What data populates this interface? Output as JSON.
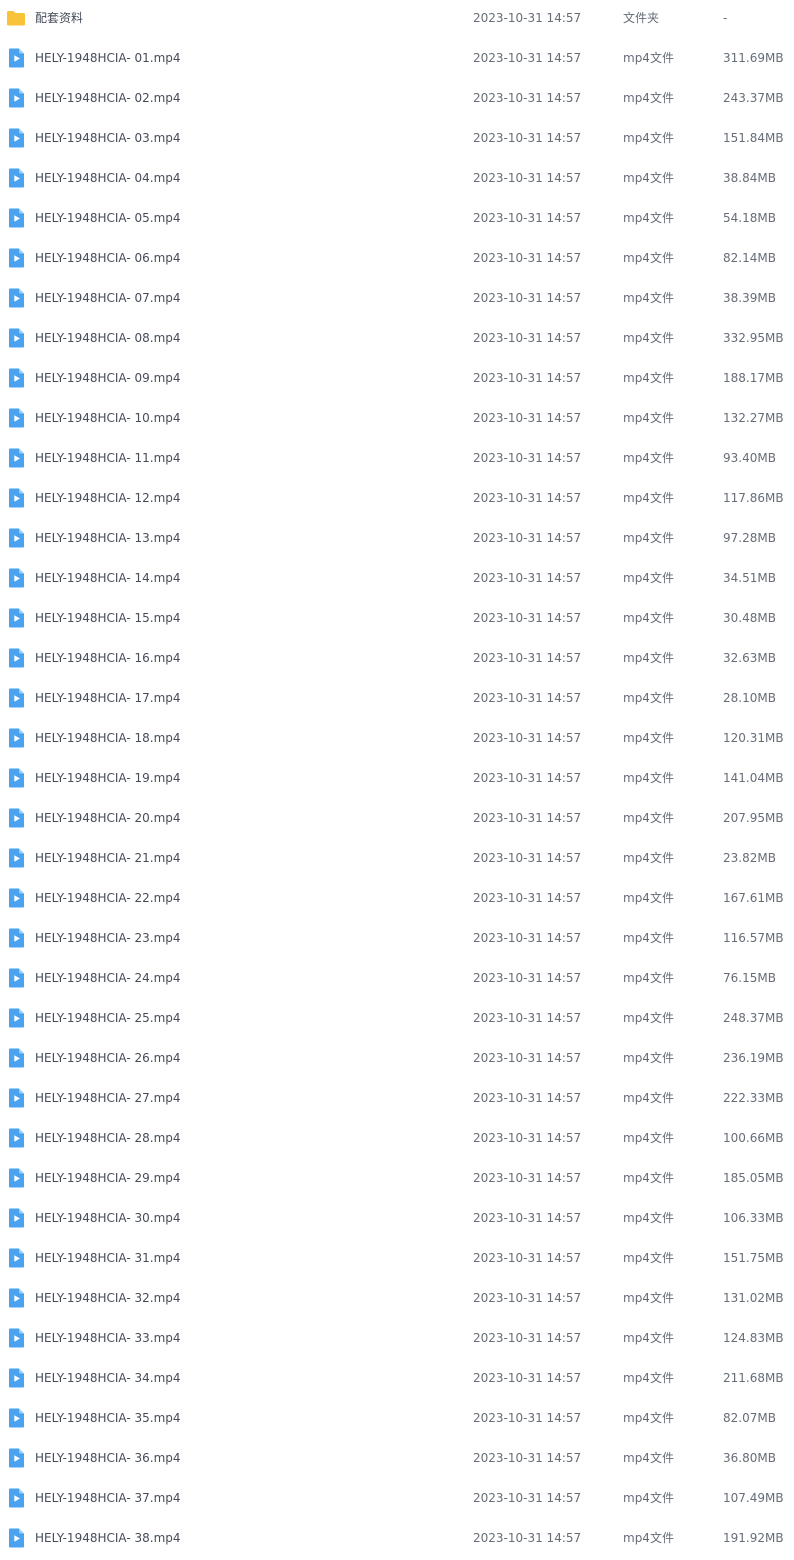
{
  "icons": {
    "folder": "folder-icon",
    "video": "video-file-icon"
  },
  "colors": {
    "folder": "#f8c33a",
    "video": "#4aa3f0"
  },
  "files": [
    {
      "icon": "folder",
      "name": "配套资料",
      "modified": "2023-10-31 14:57",
      "type": "文件夹",
      "size": "-"
    },
    {
      "icon": "video",
      "name": "HELY-1948HCIA- 01.mp4",
      "modified": "2023-10-31 14:57",
      "type": "mp4文件",
      "size": "311.69MB"
    },
    {
      "icon": "video",
      "name": "HELY-1948HCIA- 02.mp4",
      "modified": "2023-10-31 14:57",
      "type": "mp4文件",
      "size": "243.37MB"
    },
    {
      "icon": "video",
      "name": "HELY-1948HCIA- 03.mp4",
      "modified": "2023-10-31 14:57",
      "type": "mp4文件",
      "size": "151.84MB"
    },
    {
      "icon": "video",
      "name": "HELY-1948HCIA- 04.mp4",
      "modified": "2023-10-31 14:57",
      "type": "mp4文件",
      "size": "38.84MB"
    },
    {
      "icon": "video",
      "name": "HELY-1948HCIA- 05.mp4",
      "modified": "2023-10-31 14:57",
      "type": "mp4文件",
      "size": "54.18MB"
    },
    {
      "icon": "video",
      "name": "HELY-1948HCIA- 06.mp4",
      "modified": "2023-10-31 14:57",
      "type": "mp4文件",
      "size": "82.14MB"
    },
    {
      "icon": "video",
      "name": "HELY-1948HCIA- 07.mp4",
      "modified": "2023-10-31 14:57",
      "type": "mp4文件",
      "size": "38.39MB"
    },
    {
      "icon": "video",
      "name": "HELY-1948HCIA- 08.mp4",
      "modified": "2023-10-31 14:57",
      "type": "mp4文件",
      "size": "332.95MB"
    },
    {
      "icon": "video",
      "name": "HELY-1948HCIA- 09.mp4",
      "modified": "2023-10-31 14:57",
      "type": "mp4文件",
      "size": "188.17MB"
    },
    {
      "icon": "video",
      "name": "HELY-1948HCIA- 10.mp4",
      "modified": "2023-10-31 14:57",
      "type": "mp4文件",
      "size": "132.27MB"
    },
    {
      "icon": "video",
      "name": "HELY-1948HCIA- 11.mp4",
      "modified": "2023-10-31 14:57",
      "type": "mp4文件",
      "size": "93.40MB"
    },
    {
      "icon": "video",
      "name": "HELY-1948HCIA- 12.mp4",
      "modified": "2023-10-31 14:57",
      "type": "mp4文件",
      "size": "117.86MB"
    },
    {
      "icon": "video",
      "name": "HELY-1948HCIA- 13.mp4",
      "modified": "2023-10-31 14:57",
      "type": "mp4文件",
      "size": "97.28MB"
    },
    {
      "icon": "video",
      "name": "HELY-1948HCIA- 14.mp4",
      "modified": "2023-10-31 14:57",
      "type": "mp4文件",
      "size": "34.51MB"
    },
    {
      "icon": "video",
      "name": "HELY-1948HCIA- 15.mp4",
      "modified": "2023-10-31 14:57",
      "type": "mp4文件",
      "size": "30.48MB"
    },
    {
      "icon": "video",
      "name": "HELY-1948HCIA- 16.mp4",
      "modified": "2023-10-31 14:57",
      "type": "mp4文件",
      "size": "32.63MB"
    },
    {
      "icon": "video",
      "name": "HELY-1948HCIA- 17.mp4",
      "modified": "2023-10-31 14:57",
      "type": "mp4文件",
      "size": "28.10MB"
    },
    {
      "icon": "video",
      "name": "HELY-1948HCIA- 18.mp4",
      "modified": "2023-10-31 14:57",
      "type": "mp4文件",
      "size": "120.31MB"
    },
    {
      "icon": "video",
      "name": "HELY-1948HCIA- 19.mp4",
      "modified": "2023-10-31 14:57",
      "type": "mp4文件",
      "size": "141.04MB"
    },
    {
      "icon": "video",
      "name": "HELY-1948HCIA- 20.mp4",
      "modified": "2023-10-31 14:57",
      "type": "mp4文件",
      "size": "207.95MB"
    },
    {
      "icon": "video",
      "name": "HELY-1948HCIA- 21.mp4",
      "modified": "2023-10-31 14:57",
      "type": "mp4文件",
      "size": "23.82MB"
    },
    {
      "icon": "video",
      "name": "HELY-1948HCIA- 22.mp4",
      "modified": "2023-10-31 14:57",
      "type": "mp4文件",
      "size": "167.61MB"
    },
    {
      "icon": "video",
      "name": "HELY-1948HCIA- 23.mp4",
      "modified": "2023-10-31 14:57",
      "type": "mp4文件",
      "size": "116.57MB"
    },
    {
      "icon": "video",
      "name": "HELY-1948HCIA- 24.mp4",
      "modified": "2023-10-31 14:57",
      "type": "mp4文件",
      "size": "76.15MB"
    },
    {
      "icon": "video",
      "name": "HELY-1948HCIA- 25.mp4",
      "modified": "2023-10-31 14:57",
      "type": "mp4文件",
      "size": "248.37MB"
    },
    {
      "icon": "video",
      "name": "HELY-1948HCIA- 26.mp4",
      "modified": "2023-10-31 14:57",
      "type": "mp4文件",
      "size": "236.19MB"
    },
    {
      "icon": "video",
      "name": "HELY-1948HCIA- 27.mp4",
      "modified": "2023-10-31 14:57",
      "type": "mp4文件",
      "size": "222.33MB"
    },
    {
      "icon": "video",
      "name": "HELY-1948HCIA- 28.mp4",
      "modified": "2023-10-31 14:57",
      "type": "mp4文件",
      "size": "100.66MB"
    },
    {
      "icon": "video",
      "name": "HELY-1948HCIA- 29.mp4",
      "modified": "2023-10-31 14:57",
      "type": "mp4文件",
      "size": "185.05MB"
    },
    {
      "icon": "video",
      "name": "HELY-1948HCIA- 30.mp4",
      "modified": "2023-10-31 14:57",
      "type": "mp4文件",
      "size": "106.33MB"
    },
    {
      "icon": "video",
      "name": "HELY-1948HCIA- 31.mp4",
      "modified": "2023-10-31 14:57",
      "type": "mp4文件",
      "size": "151.75MB"
    },
    {
      "icon": "video",
      "name": "HELY-1948HCIA- 32.mp4",
      "modified": "2023-10-31 14:57",
      "type": "mp4文件",
      "size": "131.02MB"
    },
    {
      "icon": "video",
      "name": "HELY-1948HCIA- 33.mp4",
      "modified": "2023-10-31 14:57",
      "type": "mp4文件",
      "size": "124.83MB"
    },
    {
      "icon": "video",
      "name": "HELY-1948HCIA- 34.mp4",
      "modified": "2023-10-31 14:57",
      "type": "mp4文件",
      "size": "211.68MB"
    },
    {
      "icon": "video",
      "name": "HELY-1948HCIA- 35.mp4",
      "modified": "2023-10-31 14:57",
      "type": "mp4文件",
      "size": "82.07MB"
    },
    {
      "icon": "video",
      "name": "HELY-1948HCIA- 36.mp4",
      "modified": "2023-10-31 14:57",
      "type": "mp4文件",
      "size": "36.80MB"
    },
    {
      "icon": "video",
      "name": "HELY-1948HCIA- 37.mp4",
      "modified": "2023-10-31 14:57",
      "type": "mp4文件",
      "size": "107.49MB"
    },
    {
      "icon": "video",
      "name": "HELY-1948HCIA- 38.mp4",
      "modified": "2023-10-31 14:57",
      "type": "mp4文件",
      "size": "191.92MB"
    }
  ]
}
